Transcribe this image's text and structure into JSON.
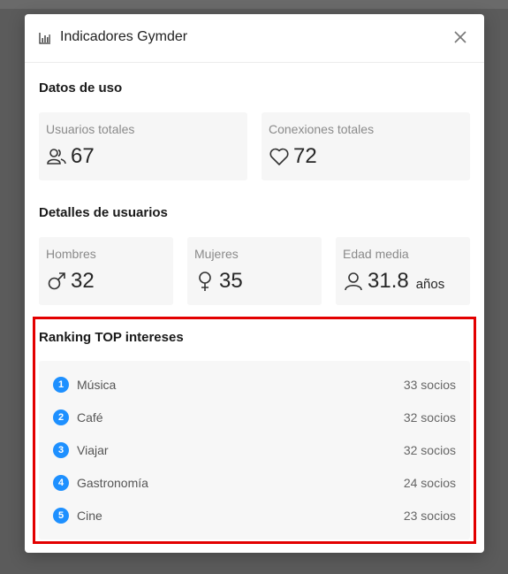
{
  "modal": {
    "title": "Indicadores Gymder",
    "icons": {
      "header": "bar-chart-icon",
      "close": "close-icon"
    }
  },
  "usage": {
    "title": "Datos de uso",
    "cards": [
      {
        "label": "Usuarios totales",
        "value": "67",
        "icon": "users-icon"
      },
      {
        "label": "Conexiones totales",
        "value": "72",
        "icon": "heart-icon"
      }
    ]
  },
  "user_details": {
    "title": "Detalles de usuarios",
    "cards": [
      {
        "label": "Hombres",
        "value": "32",
        "icon": "male-icon"
      },
      {
        "label": "Mujeres",
        "value": "35",
        "icon": "female-icon"
      },
      {
        "label": "Edad media",
        "value": "31.8",
        "unit": "años",
        "icon": "user-icon"
      }
    ]
  },
  "ranking": {
    "title": "Ranking TOP intereses",
    "items": [
      {
        "rank": "1",
        "label": "Música",
        "count": "33 socios"
      },
      {
        "rank": "2",
        "label": "Café",
        "count": "32 socios"
      },
      {
        "rank": "3",
        "label": "Viajar",
        "count": "32 socios"
      },
      {
        "rank": "4",
        "label": "Gastronomía",
        "count": "24 socios"
      },
      {
        "rank": "5",
        "label": "Cine",
        "count": "23 socios"
      }
    ],
    "accent_color": "#1e90ff",
    "highlight_color": "#e30000"
  }
}
